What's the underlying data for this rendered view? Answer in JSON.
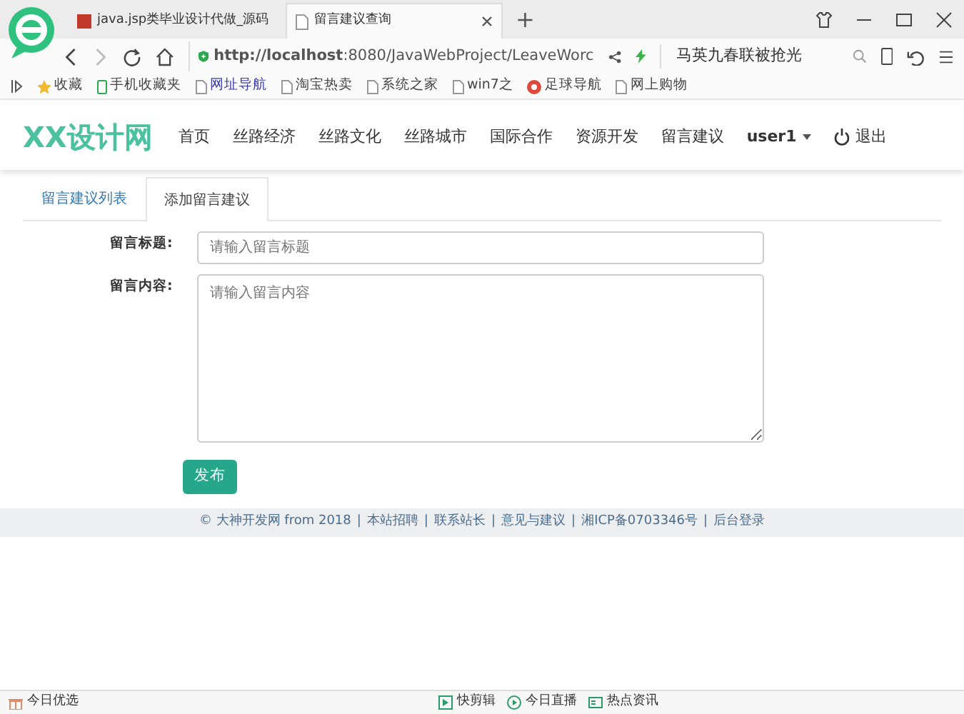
{
  "browser": {
    "tabs": [
      {
        "label": "java.jsp类毕业设计代做_源码",
        "selected": false
      },
      {
        "label": "留言建议查询",
        "selected": true
      }
    ],
    "new_tab": "+",
    "url_host": "http://localhost",
    "url_rest": ":8080/JavaWebProject/LeaveWorc",
    "search_value": "马英九春联被抢光",
    "bookmarks": [
      "收藏",
      "手机收藏夹",
      "网址导航",
      "淘宝热卖",
      "系统之家",
      "win7之",
      "足球导航",
      "网上购物"
    ]
  },
  "site": {
    "logo": "XX设计网",
    "nav": [
      {
        "label": "首页"
      },
      {
        "label": "丝路经济"
      },
      {
        "label": "丝路文化"
      },
      {
        "label": "丝路城市"
      },
      {
        "label": "国际合作"
      },
      {
        "label": "资源开发"
      },
      {
        "label": "留言建议"
      }
    ],
    "user": "user1",
    "logout": "退出"
  },
  "tabs": [
    {
      "label": "留言建议列表",
      "selected": false
    },
    {
      "label": "添加留言建议",
      "selected": true
    }
  ],
  "form": {
    "fields": [
      {
        "kind": "input",
        "label": "留言标题:",
        "placeholder": "请输入留言标题"
      },
      {
        "kind": "textarea",
        "label": "留言内容:",
        "placeholder": "请输入留言内容"
      }
    ],
    "submit": "发布"
  },
  "footer": {
    "copyright": "© 大神开发网 from 2018",
    "separator": "|",
    "links": [
      "本站招聘",
      "联系站长",
      "意见与建议",
      "湘ICP备0703346号",
      "后台登录"
    ]
  },
  "status_bar": {
    "left": "今日优选",
    "items": [
      "快剪辑",
      "今日直播",
      "热点资讯"
    ]
  }
}
